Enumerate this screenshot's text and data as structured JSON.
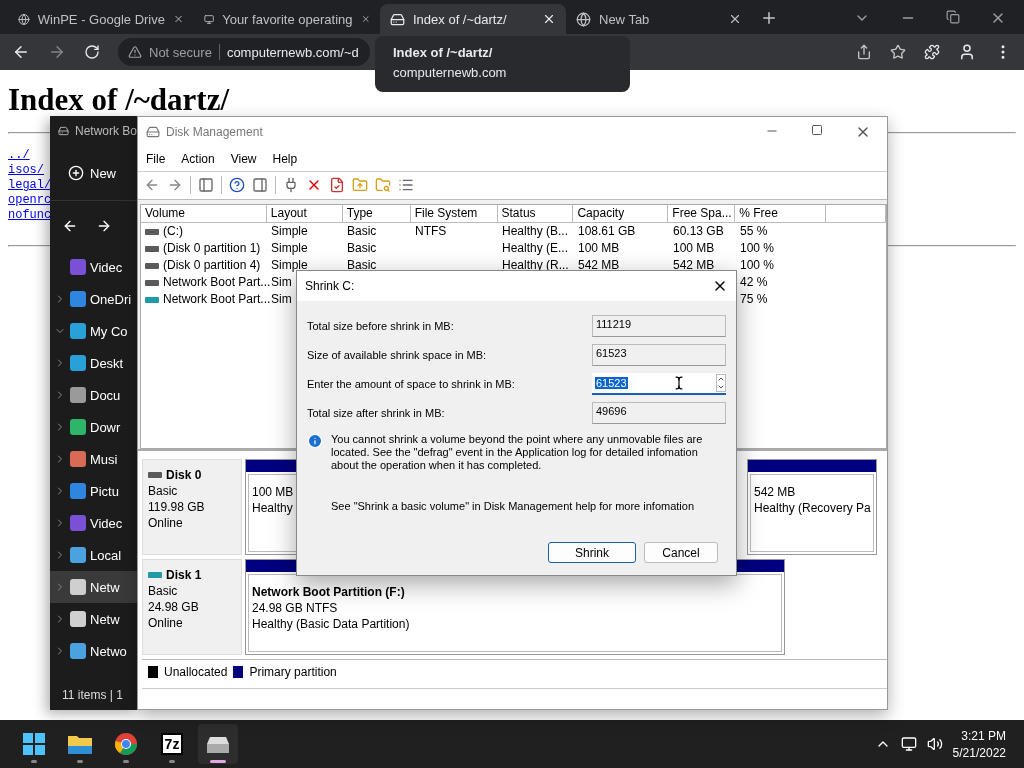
{
  "browser": {
    "tabs": [
      {
        "title": "WinPE - Google Drive",
        "selected": false
      },
      {
        "title": "Your favorite operating",
        "selected": false
      },
      {
        "title": "Index of /~dartz/",
        "selected": true
      },
      {
        "title": "New Tab",
        "selected": false
      }
    ],
    "security": "Not secure",
    "url": "computernewb.com/~d",
    "tooltip": {
      "title": "Index of /~dartz/",
      "url": "computernewb.com"
    }
  },
  "page": {
    "heading": "Index of /~dartz/",
    "links": [
      "../",
      "isos/",
      "legal/",
      "openrc",
      "nofunc"
    ]
  },
  "explorer": {
    "title": "Network Bo",
    "new_button": "New",
    "status": "11 items  |  1",
    "items": [
      {
        "label": "Videc",
        "selected": false
      },
      {
        "label": "OneDri",
        "expanded": false,
        "selected": false
      },
      {
        "label": "My Co",
        "expanded": true,
        "selected": false
      },
      {
        "label": "Deskt",
        "expanded": false,
        "selected": false
      },
      {
        "label": "Docu",
        "expanded": false,
        "selected": false
      },
      {
        "label": "Dowr",
        "expanded": false,
        "selected": false
      },
      {
        "label": "Musi",
        "expanded": false,
        "selected": false
      },
      {
        "label": "Pictu",
        "expanded": false,
        "selected": false
      },
      {
        "label": "Videc",
        "expanded": false,
        "selected": false
      },
      {
        "label": "Local",
        "expanded": false,
        "selected": false
      },
      {
        "label": "Netw",
        "expanded": false,
        "selected": true
      },
      {
        "label": "Netw",
        "expanded": false,
        "selected": false
      },
      {
        "label": "Netwo",
        "expanded": false,
        "selected": false
      }
    ]
  },
  "disk_management": {
    "title": "Disk Management",
    "menu": [
      "File",
      "Action",
      "View",
      "Help"
    ],
    "columns": [
      "Volume",
      "Layout",
      "Type",
      "File System",
      "Status",
      "Capacity",
      "Free Spa...",
      "% Free"
    ],
    "rows": [
      {
        "color": "#5a5a5a",
        "cells": [
          "(C:)",
          "Simple",
          "Basic",
          "NTFS",
          "Healthy (B...",
          "108.61 GB",
          "60.13 GB",
          "55 %"
        ]
      },
      {
        "color": "#5a5a5a",
        "cells": [
          "(Disk 0 partition 1)",
          "Simple",
          "Basic",
          null,
          "Healthy (E...",
          "100 MB",
          "100 MB",
          "100 %"
        ]
      },
      {
        "color": "#5a5a5a",
        "cells": [
          "(Disk 0 partition 4)",
          "Simple",
          "Basic",
          null,
          "Healthy (R...",
          "542 MB",
          "542 MB",
          "100 %"
        ]
      },
      {
        "color": "#5a5a5a",
        "cells": [
          "Network Boot Part...",
          "Sim",
          null,
          null,
          null,
          null,
          null,
          "42 %"
        ]
      },
      {
        "color": "#1f9aa8",
        "cells": [
          "Network Boot Part...",
          "Sim",
          null,
          null,
          null,
          null,
          null,
          "75 %"
        ]
      }
    ],
    "disks": [
      {
        "name": "Disk 0",
        "type": "Basic",
        "size": "119.98 GB",
        "state": "Online",
        "color": "#5a5a5a",
        "partitions": [
          {
            "size": "100 MB",
            "status": "Healthy"
          },
          {
            "size": "542 MB",
            "status": "Healthy (Recovery Pa"
          }
        ]
      },
      {
        "name": "Disk 1",
        "type": "Basic",
        "size": "24.98 GB",
        "state": "Online",
        "color": "#1f9aa8",
        "partitions": [
          {
            "label": "Network Boot Partition  (F:)",
            "size": "24.98 GB NTFS",
            "status": "Healthy (Basic Data Partition)"
          }
        ]
      }
    ],
    "legend": [
      {
        "label": "Unallocated",
        "color": "#000000"
      },
      {
        "label": "Primary partition",
        "color": "#000080"
      }
    ]
  },
  "dialog": {
    "title": "Shrink C:",
    "fields": [
      {
        "label": "Total size before shrink in MB:",
        "value": "111219",
        "kind": "readonly"
      },
      {
        "label": "Size of available shrink space in MB:",
        "value": "61523",
        "kind": "readonly"
      },
      {
        "label": "Enter the amount of space to shrink in MB:",
        "value": "61523",
        "kind": "spin"
      },
      {
        "label": "Total size after shrink in MB:",
        "value": "49696",
        "kind": "readonly"
      }
    ],
    "info": "You cannot shrink a volume beyond the point where any unmovable files are located. See the \"defrag\" event in the Application log for detailed infomation about the operation when it has completed.",
    "help": "See \"Shrink a basic volume\" in Disk Management help for more infomation",
    "buttons": [
      {
        "label": "Shrink",
        "default": true
      },
      {
        "label": "Cancel",
        "default": false
      }
    ]
  },
  "taskbar": {
    "apps": [
      {
        "active": false
      },
      {
        "active": false
      },
      {
        "active": false
      },
      {
        "label": "7z",
        "active": false
      },
      {
        "active": true
      }
    ],
    "time": "3:21 PM",
    "date": "5/21/2022"
  }
}
